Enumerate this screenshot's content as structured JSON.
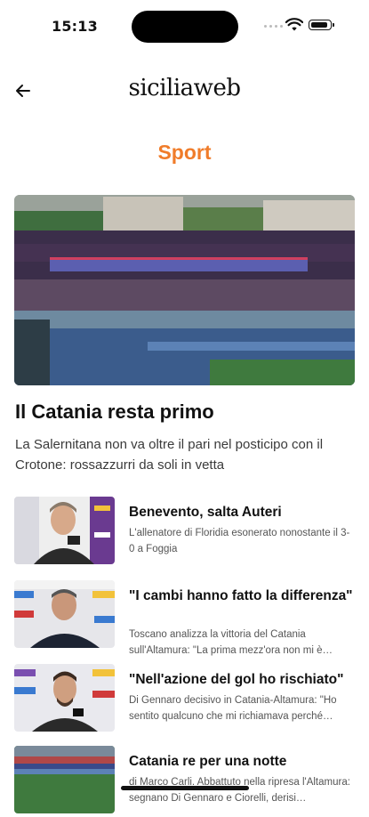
{
  "status": {
    "time": "15:13"
  },
  "header": {
    "back_icon": "arrow-left-icon",
    "logo": "siciliaweb"
  },
  "section": {
    "title": "Sport",
    "accent": "#f07c2a"
  },
  "featured": {
    "title": "Il Catania resta primo",
    "summary": "La Salernitana non va oltre il pari nel posticipo con il Crotone: rossazzurri da soli in vetta"
  },
  "articles": [
    {
      "title": "Benevento, salta Auteri",
      "summary": "L'allenatore di Floridia esonerato nonostante il 3-0 a Foggia"
    },
    {
      "title": "\"I cambi hanno fatto la differenza\"",
      "summary": "Toscano analizza la vittoria del Catania sull'Altamura: \"La prima mezz'ora non mi è…"
    },
    {
      "title": "\"Nell'azione del gol ho rischiato\"",
      "summary": "Di Gennaro decisivo in Catania-Altamura: \"Ho sentito qualcuno che mi richiamava perché…"
    },
    {
      "title": "Catania re per una notte",
      "summary": "di Marco Carli. Abbattuto nella ripresa l'Altamura: segnano Di Gennaro e Ciorelli, derisi…"
    }
  ]
}
